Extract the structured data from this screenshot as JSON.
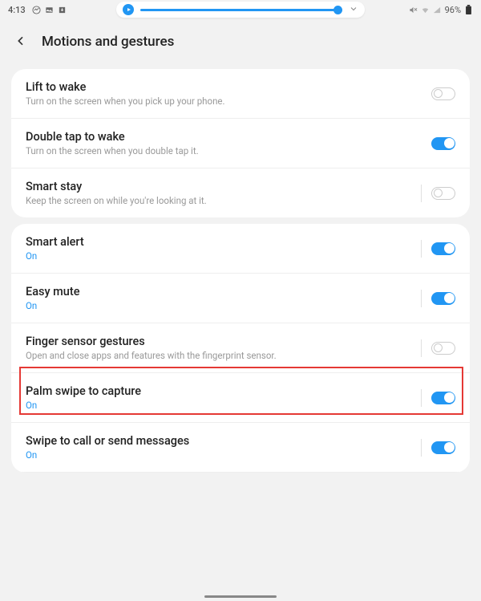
{
  "status": {
    "time": "4:13",
    "battery": "96%"
  },
  "header": {
    "title": "Motions and gestures"
  },
  "card1": {
    "items": [
      {
        "title": "Lift to wake",
        "sub": "Turn on the screen when you pick up your phone.",
        "on": false
      },
      {
        "title": "Double tap to wake",
        "sub": "Turn on the screen when you double tap it.",
        "on": true
      },
      {
        "title": "Smart stay",
        "sub": "Keep the screen on while you're looking at it.",
        "on": false
      }
    ]
  },
  "card2": {
    "items": [
      {
        "title": "Smart alert",
        "status": "On",
        "on": true
      },
      {
        "title": "Easy mute",
        "status": "On",
        "on": true
      },
      {
        "title": "Finger sensor gestures",
        "sub": "Open and close apps and features with the fingerprint sensor.",
        "on": false
      },
      {
        "title": "Palm swipe to capture",
        "status": "On",
        "on": true,
        "highlight": true
      },
      {
        "title": "Swipe to call or send messages",
        "status": "On",
        "on": true
      }
    ]
  }
}
